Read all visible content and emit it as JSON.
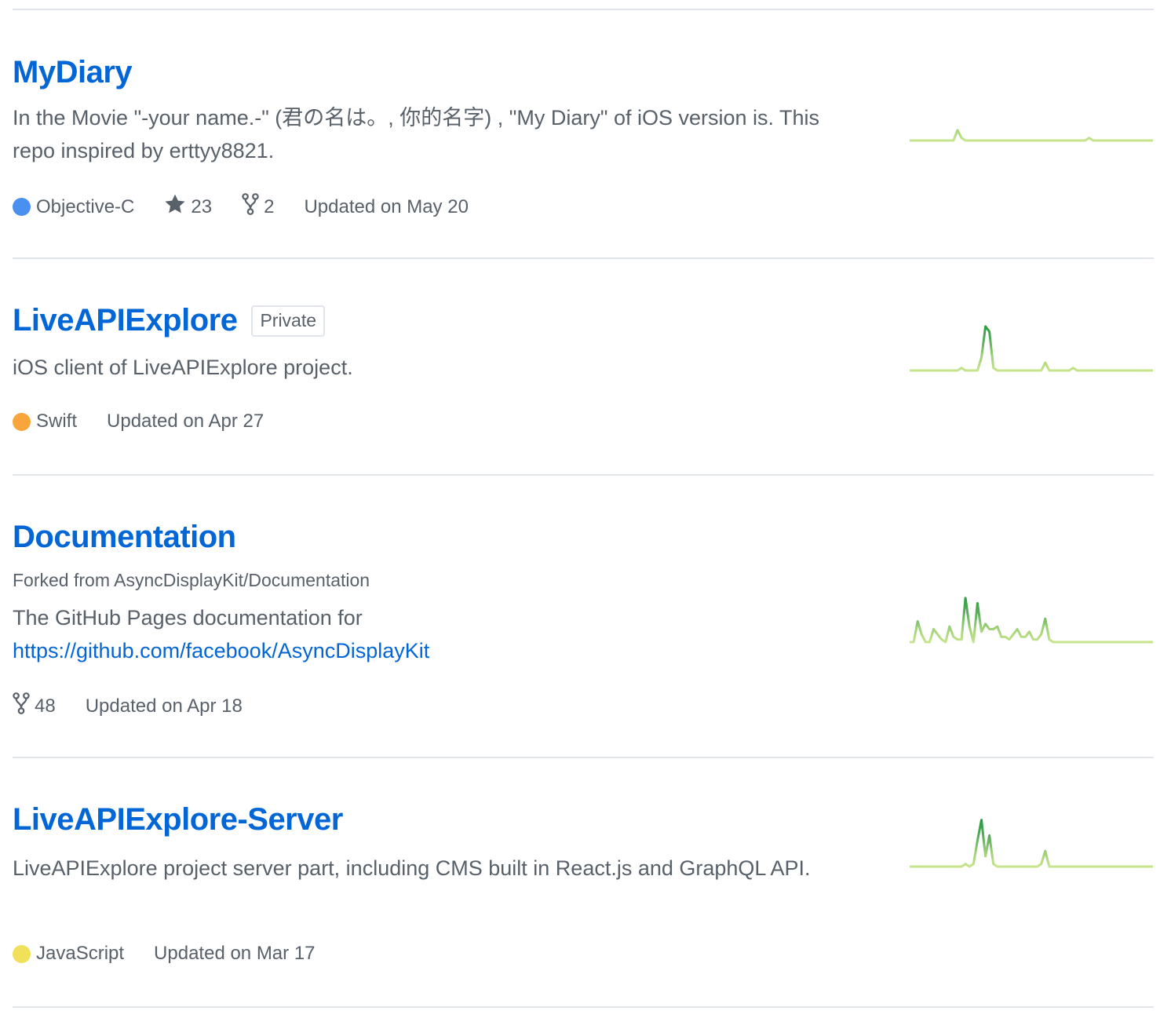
{
  "repos": [
    {
      "name": "MyDiary",
      "private_label": "",
      "forked_from_prefix": "",
      "forked_from_repo": "",
      "description": "In the Movie \"-your name.-\" (君の名は。, 你的名字) , \"My Diary\" of iOS version is. This repo inspired by erttyy8821.",
      "description_link": "",
      "language": "Objective-C",
      "language_color": "#4a90f0",
      "stars": "23",
      "forks": "2",
      "updated": "Updated on May 20",
      "activity": [
        0,
        0,
        0,
        0,
        0,
        0,
        0,
        0,
        0,
        0,
        0,
        0,
        4,
        1,
        0,
        0,
        0,
        0,
        0,
        0,
        0,
        0,
        0,
        0,
        0,
        0,
        0,
        0,
        0,
        0,
        0,
        0,
        0,
        0,
        0,
        0,
        0,
        0,
        0,
        0,
        0,
        0,
        0,
        0,
        0,
        1,
        0,
        0,
        0,
        0,
        0,
        0,
        0,
        0,
        0,
        0,
        0,
        0,
        0,
        0,
        0,
        0
      ]
    },
    {
      "name": "LiveAPIExplore",
      "private_label": "Private",
      "forked_from_prefix": "",
      "forked_from_repo": "",
      "description": "iOS client of LiveAPIExplore project.",
      "description_link": "",
      "language": "Swift",
      "language_color": "#f8a63c",
      "stars": "",
      "forks": "",
      "updated": "Updated on Apr 27",
      "activity": [
        0,
        0,
        0,
        0,
        0,
        0,
        0,
        0,
        0,
        0,
        0,
        0,
        0,
        1,
        0,
        0,
        0,
        0,
        5,
        17,
        15,
        1,
        0,
        0,
        0,
        0,
        0,
        0,
        0,
        0,
        0,
        0,
        0,
        0,
        3,
        0,
        0,
        0,
        0,
        0,
        0,
        1,
        0,
        0,
        0,
        0,
        0,
        0,
        0,
        0,
        0,
        0,
        0,
        0,
        0,
        0,
        0,
        0,
        0,
        0,
        0,
        0
      ]
    },
    {
      "name": "Documentation",
      "private_label": "",
      "forked_from_prefix": "Forked from ",
      "forked_from_repo": "AsyncDisplayKit/Documentation",
      "description": "The GitHub Pages documentation for",
      "description_link": "https://github.com/facebook/AsyncDisplayKit",
      "language": "",
      "language_color": "",
      "stars": "",
      "forks": "48",
      "updated": "Updated on Apr 18",
      "activity": [
        0,
        0,
        8,
        3,
        0,
        0,
        5,
        3,
        1,
        0,
        6,
        2,
        1,
        1,
        17,
        6,
        0,
        15,
        4,
        7,
        5,
        5,
        6,
        2,
        2,
        1,
        3,
        5,
        2,
        2,
        4,
        1,
        1,
        3,
        9,
        1,
        0,
        0,
        0,
        0,
        0,
        0,
        0,
        0,
        0,
        0,
        0,
        0,
        0,
        0,
        0,
        0,
        0,
        0,
        0,
        0,
        0,
        0,
        0,
        0,
        0,
        0
      ]
    },
    {
      "name": "LiveAPIExplore-Server",
      "private_label": "",
      "forked_from_prefix": "",
      "forked_from_repo": "",
      "description": "LiveAPIExplore project server part, including CMS built in React.js and GraphQL API.",
      "description_link": "",
      "language": "JavaScript",
      "language_color": "#f1e05a",
      "stars": "",
      "forks": "",
      "updated": "Updated on Mar 17",
      "activity": [
        0,
        0,
        0,
        0,
        0,
        0,
        0,
        0,
        0,
        0,
        0,
        0,
        0,
        0,
        1,
        0,
        1,
        10,
        18,
        4,
        12,
        1,
        0,
        0,
        0,
        0,
        0,
        0,
        0,
        0,
        0,
        0,
        0,
        1,
        6,
        0,
        0,
        0,
        0,
        0,
        0,
        0,
        0,
        0,
        0,
        0,
        0,
        0,
        0,
        0,
        0,
        0,
        0,
        0,
        0,
        0,
        0,
        0,
        0,
        0,
        0,
        0
      ]
    }
  ],
  "colors": {
    "link": "#0366d6",
    "muted": "#586069",
    "border": "#e1e4e8",
    "spark_low": "#c6e48b",
    "spark_high": "#239a3b"
  },
  "icons": {
    "star": "star-icon",
    "fork": "fork-icon"
  }
}
